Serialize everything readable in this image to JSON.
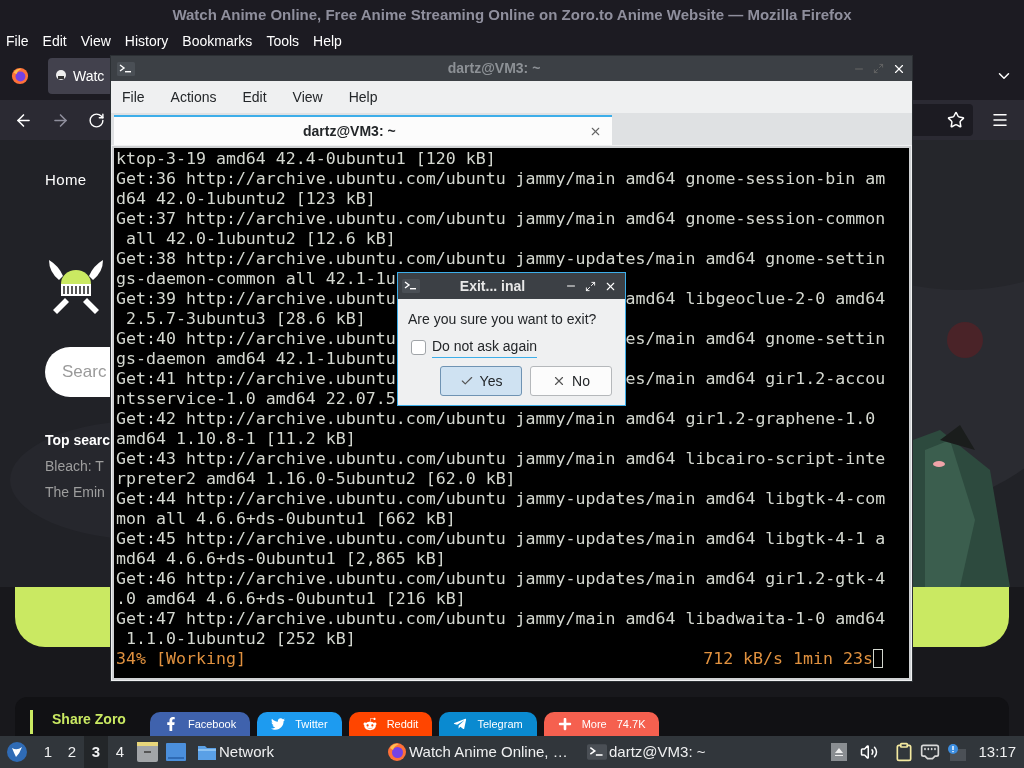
{
  "browser": {
    "title": "Watch Anime Online, Free Anime Streaming Online on Zoro.to Anime Website — Mozilla Firefox",
    "menu": [
      "File",
      "Edit",
      "View",
      "History",
      "Bookmarks",
      "Tools",
      "Help"
    ],
    "tab": {
      "label": "Watc"
    },
    "page": {
      "nav": "Home",
      "search": {
        "placeholder": "Searc"
      },
      "top_search": {
        "title": "Top searc",
        "items": [
          "Bleach: T",
          "The Emin"
        ]
      },
      "share": {
        "title": "Share Zoro",
        "buttons": [
          {
            "kind": "facebook",
            "label": "Facebook",
            "color": "#3f62ad"
          },
          {
            "kind": "twitter",
            "label": "Twitter",
            "color": "#1d9bf0"
          },
          {
            "kind": "reddit",
            "label": "Reddit",
            "color": "#ff4500"
          },
          {
            "kind": "telegram",
            "label": "Telegram",
            "color": "#0a8ad0"
          },
          {
            "kind": "more",
            "label": "More",
            "count": "74.7K",
            "color": "#f5604f"
          }
        ]
      }
    }
  },
  "terminal": {
    "title": "dartz@VM3: ~",
    "menu": [
      "File",
      "Actions",
      "Edit",
      "View",
      "Help"
    ],
    "tab": {
      "label": "dartz@VM3: ~"
    },
    "lines": [
      {
        "kind": "line",
        "text": "ktop-3-19 amd64 42.4-0ubuntu1 [120 kB]"
      },
      {
        "kind": "line",
        "text": "Get:36 http://archive.ubuntu.com/ubuntu jammy/main amd64 gnome-session-bin am"
      },
      {
        "kind": "line",
        "text": "d64 42.0-1ubuntu2 [123 kB]"
      },
      {
        "kind": "line",
        "text": "Get:37 http://archive.ubuntu.com/ubuntu jammy/main amd64 gnome-session-common"
      },
      {
        "kind": "line",
        "text": " all 42.0-1ubuntu2 [12.6 kB]"
      },
      {
        "kind": "line",
        "text": "Get:38 http://archive.ubuntu.com/ubuntu jammy-updates/main amd64 gnome-settin"
      },
      {
        "kind": "covered",
        "text": "gs-daemon-common all 42.1-1u"
      },
      {
        "kind": "covered",
        "text": "Get:39 http://archive.ubuntu",
        "after": "amd64 libgeoclue-2-0 amd64"
      },
      {
        "kind": "line",
        "text": " 2.5.7-3ubuntu3 [28.6 kB]"
      },
      {
        "kind": "covered",
        "text": "Get:40 http://archive.ubuntu",
        "after": "es/main amd64 gnome-settin"
      },
      {
        "kind": "covered",
        "text": "gs-daemon amd64 42.1-1ubuntu"
      },
      {
        "kind": "covered",
        "text": "Get:41 http://archive.ubuntu",
        "after": "es/main amd64 gir1.2-accou"
      },
      {
        "kind": "covered",
        "text": "ntsservice-1.0 amd64 22.07.5"
      },
      {
        "kind": "line",
        "text": "Get:42 http://archive.ubuntu.com/ubuntu jammy/main amd64 gir1.2-graphene-1.0"
      },
      {
        "kind": "line",
        "text": "amd64 1.10.8-1 [11.2 kB]"
      },
      {
        "kind": "line",
        "text": "Get:43 http://archive.ubuntu.com/ubuntu jammy/main amd64 libcairo-script-inte"
      },
      {
        "kind": "line",
        "text": "rpreter2 amd64 1.16.0-5ubuntu2 [62.0 kB]"
      },
      {
        "kind": "line",
        "text": "Get:44 http://archive.ubuntu.com/ubuntu jammy-updates/main amd64 libgtk-4-com"
      },
      {
        "kind": "line",
        "text": "mon all 4.6.6+ds-0ubuntu1 [662 kB]"
      },
      {
        "kind": "line",
        "text": "Get:45 http://archive.ubuntu.com/ubuntu jammy-updates/main amd64 libgtk-4-1 a"
      },
      {
        "kind": "line",
        "text": "md64 4.6.6+ds-0ubuntu1 [2,865 kB]"
      },
      {
        "kind": "line",
        "text": "Get:46 http://archive.ubuntu.com/ubuntu jammy-updates/main amd64 gir1.2-gtk-4"
      },
      {
        "kind": "line",
        "text": ".0 amd64 4.6.6+ds-0ubuntu1 [216 kB]"
      },
      {
        "kind": "line",
        "text": "Get:47 http://archive.ubuntu.com/ubuntu jammy/main amd64 libadwaita-1-0 amd64"
      },
      {
        "kind": "line",
        "text": " 1.1.0-1ubuntu2 [252 kB]"
      }
    ],
    "status": {
      "progress": "34% [Working]",
      "speed": "712 kB/s 1min 23s"
    }
  },
  "dialog": {
    "title": "Exit... inal",
    "question": "Are you sure you want to exit?",
    "checkbox": {
      "label": "Do not ask again",
      "checked": false
    },
    "buttons": [
      {
        "kind": "yes",
        "label": "Yes",
        "selected": true
      },
      {
        "kind": "no",
        "label": "No",
        "selected": false
      }
    ]
  },
  "taskbar": {
    "workspaces": [
      {
        "label": "1",
        "selected": false
      },
      {
        "label": "2",
        "selected": false
      },
      {
        "label": "3",
        "selected": true
      },
      {
        "label": "4",
        "selected": false
      }
    ],
    "tasks": [
      {
        "kind": "folder",
        "label": "Network"
      },
      {
        "kind": "firefox",
        "label": "Watch Anime Online, …"
      },
      {
        "kind": "terminal",
        "label": "dartz@VM3: ~"
      }
    ],
    "clock": "13:17"
  }
}
